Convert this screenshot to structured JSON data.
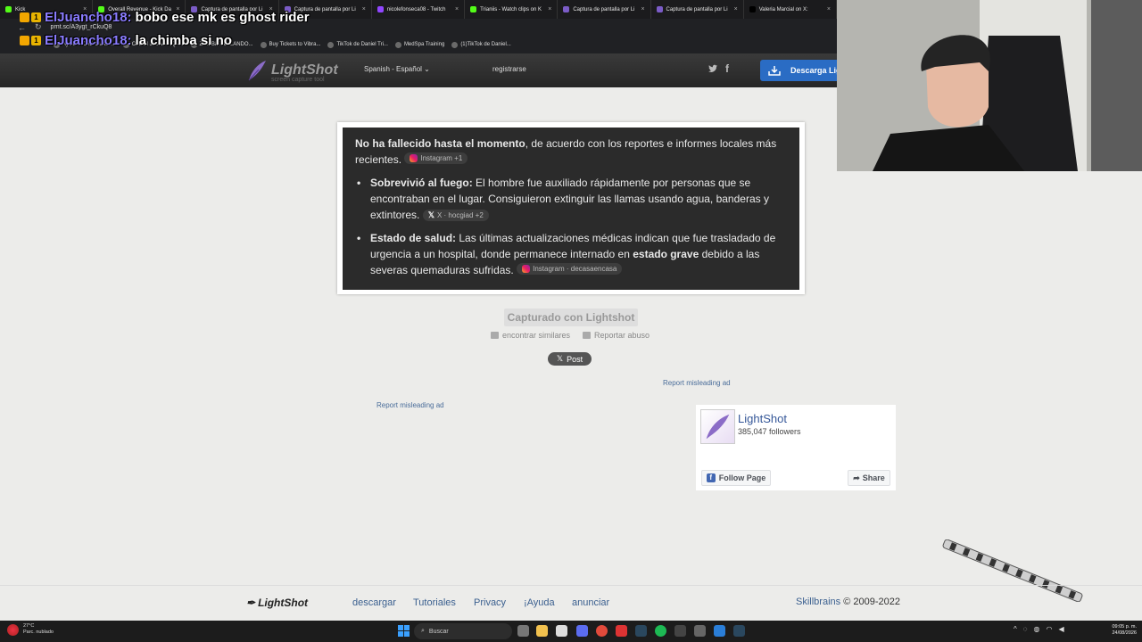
{
  "browser": {
    "tabs": [
      {
        "title": "Kick",
        "color": "#53fc18"
      },
      {
        "title": "Overall Revenue - Kick Da",
        "color": "#53fc18"
      },
      {
        "title": "Captura de pantalla por Li",
        "color": "#7b5cc7"
      },
      {
        "title": "Captura de pantalla por Li",
        "color": "#7b5cc7"
      },
      {
        "title": "nicolefonseca08 - Twitch",
        "color": "#9146ff"
      },
      {
        "title": "Trianiis - Watch clips on K",
        "color": "#53fc18"
      },
      {
        "title": "Captura de pantalla por Li",
        "color": "#7b5cc7"
      },
      {
        "title": "Captura de pantalla por Li",
        "color": "#7b5cc7"
      },
      {
        "title": "Valeria Marcial on X:",
        "color": "#000000"
      }
    ],
    "url": "prnt.sc/A3ygt_rCkuQ8",
    "bookmarks": [
      "Aydan's CoD Classe...",
      "Official JoeWo HQ -...",
      "ZOMBIE BAILANDO...",
      "Buy Tickets to Vibra...",
      "TikTok de Daniel Tri...",
      "MedSpa Training",
      "(1)TikTok de Daniel..."
    ]
  },
  "chat": [
    {
      "user": "ElJuancho18:",
      "message": "bobo ese mk es ghost rider"
    },
    {
      "user": "ElJuancho18:",
      "message": "la chimba si no"
    }
  ],
  "header": {
    "logo_name": "LightShot",
    "logo_sub": "screen capture tool",
    "language": "Spanish - Español",
    "register": "registrarse",
    "download": "Descarga Lightshot"
  },
  "screenshot": {
    "p1_bold": "No ha fallecido hasta el momento",
    "p1_text": ", de acuerdo con los reportes e informes locales más recientes.",
    "p1_chip": "Instagram +1",
    "b1_bold": "Sobrevivió al fuego:",
    "b1_text": " El hombre fue auxiliado rápidamente por personas que se encontraban en el lugar. Consiguieron extinguir las llamas usando agua, banderas y extintores.",
    "b1_chip": "X · hocgiad +2",
    "b2_bold": "Estado de salud:",
    "b2_text_a": " Las últimas actualizaciones médicas indican que fue trasladado de urgencia a un hospital, donde permanece internado en ",
    "b2_bold2": "estado grave",
    "b2_text_b": " debido a las severas quemaduras sufridas.",
    "b2_chip": "Instagram · decasaencasa"
  },
  "main": {
    "captured": "Capturado con Lightshot",
    "find_similar": "encontrar similares",
    "report_abuse": "Reportar abuso",
    "x_post": "Post",
    "report_ad": "Report misleading ad"
  },
  "fb": {
    "page_name": "LightShot",
    "followers": "385,047 followers",
    "follow": "Follow Page",
    "share": "Share"
  },
  "footer": {
    "logo": "LightShot",
    "links": [
      "descargar",
      "Tutoriales",
      "Privacy",
      "¡Ayuda",
      "anunciar"
    ],
    "company": "Skillbrains",
    "copyright": " © 2009-2022"
  },
  "taskbar": {
    "temp": "27°C",
    "weather": "Parc. nublado",
    "search": "Buscar",
    "time": "09:05 p. m.",
    "date": "24/08/2026"
  },
  "colors": {
    "accent": "#2a6cc4",
    "link": "#3a5f8f",
    "chat_user": "#8a7cff"
  }
}
